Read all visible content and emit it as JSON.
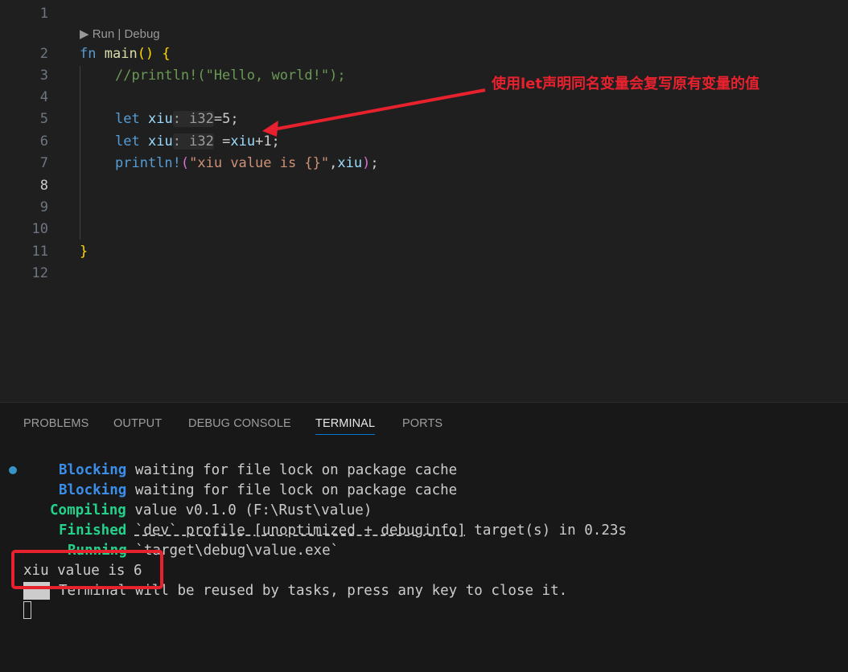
{
  "editor": {
    "line_numbers": [
      "1",
      "2",
      "3",
      "4",
      "5",
      "6",
      "7",
      "8",
      "9",
      "10",
      "11",
      "12"
    ],
    "codelens": "▶ Run | Debug",
    "lines": {
      "l2_kw": "fn",
      "l2_name": "main",
      "l2_parens": "()",
      "l2_brace": "{",
      "l3_comment": "//println!(\"Hello, world!\");",
      "l5_let": "let",
      "l5_var": "xiu",
      "l5_hint": ": i32",
      "l5_rest": "=5;",
      "l6_let": "let",
      "l6_var": "xiu",
      "l6_hint": ": i32",
      "l6_eq": " =",
      "l6_var2": "xiu",
      "l6_rest": "+1;",
      "l7_macro": "println!",
      "l7_open": "(",
      "l7_str": "\"xiu value is {}\"",
      "l7_comma": ",",
      "l7_var": "xiu",
      "l7_close": ")",
      "l7_semi": ";",
      "l11_brace": "}"
    }
  },
  "annotation": {
    "text": "使用let声明同名变量会复写原有变量的值",
    "color": "#e8212e"
  },
  "panel": {
    "tabs": [
      "PROBLEMS",
      "OUTPUT",
      "DEBUG CONSOLE",
      "TERMINAL",
      "PORTS"
    ],
    "active_tab": "TERMINAL",
    "terminal": {
      "l1_status": "Blocking",
      "l1_text": " waiting for file lock on package cache",
      "l2_status": "Blocking",
      "l2_text": " waiting for file lock on package cache",
      "l3_status": "Compiling",
      "l3_text": " value v0.1.0 (F:\\Rust\\value)",
      "l4_status": "Finished",
      "l4_u1": "`dev` profile [unoptimized + debuginfo]",
      "l4_text": " target(s) in 0.23s",
      "l5_status": "Running",
      "l5_text": " `target\\debug\\value.exe`",
      "l6_output": "xiu value is 6",
      "l7_text": "Terminal will be reused by tasks, press any key to close it."
    }
  },
  "colors": {
    "editor_bg": "#1f1f1f",
    "panel_bg": "#181818",
    "accent": "#0078d4",
    "annotation_red": "#e8212e"
  }
}
